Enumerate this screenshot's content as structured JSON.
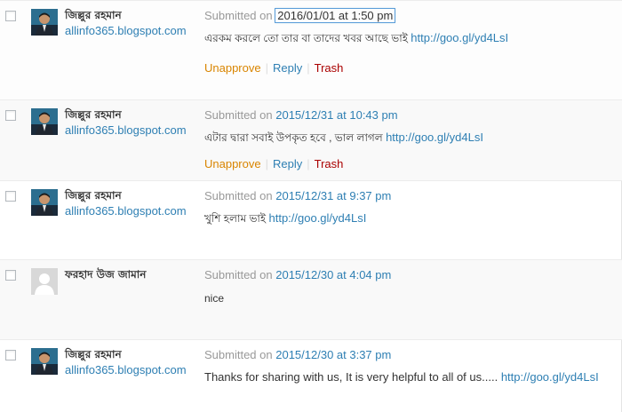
{
  "comments": [
    {
      "author": "জিল্লুর রহমান",
      "author_url": "allinfo365.blogspot.com",
      "submitted_prefix": "Submitted on",
      "date": "2016/01/01 at 1:50 pm",
      "text": "এরকম করলে তো তার বা তাদের খবর আছে ভাই",
      "link": "http://goo.gl/yd4LsI",
      "actions": [
        "Unapprove",
        "Reply",
        "Trash"
      ],
      "avatar": "photo"
    },
    {
      "author": "জিল্লুর রহমান",
      "author_url": "allinfo365.blogspot.com",
      "submitted_prefix": "Submitted on",
      "date": "2015/12/31 at 10:43 pm",
      "text": "এটার দ্বারা সবাই উপকৃত হবে , ভাল লাগল",
      "link": "http://goo.gl/yd4LsI",
      "actions": [
        "Unapprove",
        "Reply",
        "Trash"
      ],
      "avatar": "photo"
    },
    {
      "author": "জিল্লুর রহমান",
      "author_url": "allinfo365.blogspot.com",
      "submitted_prefix": "Submitted on",
      "date": "2015/12/31 at 9:37 pm",
      "text": "খুশি হলাম ভাই",
      "link": "http://goo.gl/yd4LsI",
      "actions": [],
      "avatar": "photo"
    },
    {
      "author": "ফরহাদ উজ জামান",
      "author_url": "",
      "submitted_prefix": "Submitted on",
      "date": "2015/12/30 at 4:04 pm",
      "text": "nice",
      "link": "",
      "actions": [],
      "avatar": "default"
    },
    {
      "author": "জিল্লুর রহমান",
      "author_url": "allinfo365.blogspot.com",
      "submitted_prefix": "Submitted on",
      "date": "2015/12/30 at 3:37 pm",
      "text": "Thanks for sharing with us, It is very helpful to all of us.....",
      "link": "http://goo.gl/yd4LsI",
      "actions": [],
      "avatar": "photo"
    }
  ],
  "colors": {
    "link": "#2e7fb3",
    "unapprove": "#d98500",
    "trash": "#aa0000",
    "muted": "#999999"
  }
}
